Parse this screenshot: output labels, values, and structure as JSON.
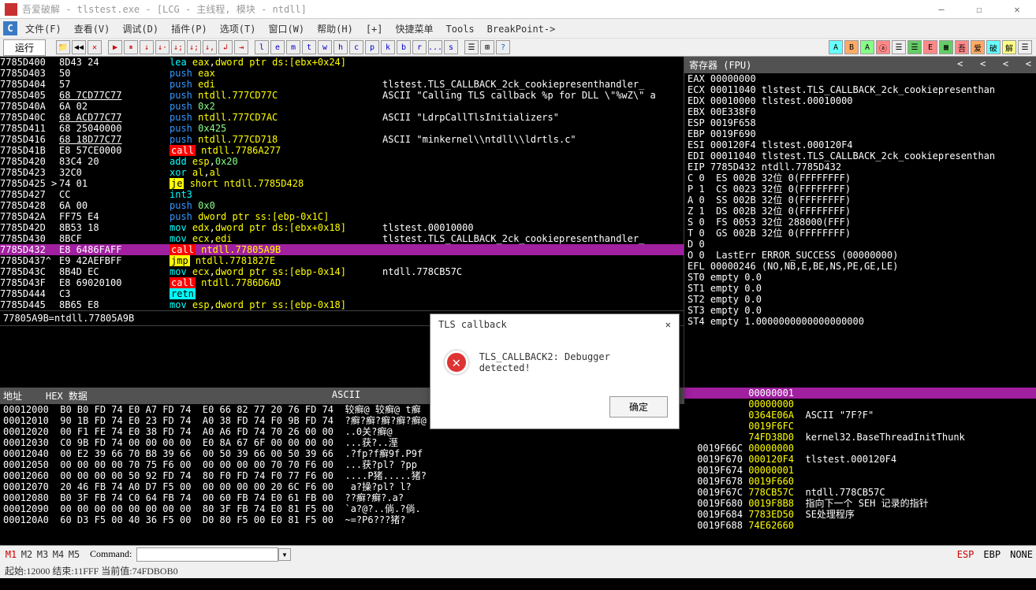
{
  "window": {
    "title": "吾爱破解 - tlstest.exe - [LCG - 主线程, 模块 - ntdll]"
  },
  "menu": [
    {
      "label": "文件(F)"
    },
    {
      "label": "查看(V)"
    },
    {
      "label": "调试(D)"
    },
    {
      "label": "插件(P)"
    },
    {
      "label": "选项(T)"
    },
    {
      "label": "窗口(W)"
    },
    {
      "label": "帮助(H)"
    },
    {
      "label": "[+]"
    },
    {
      "label": "快捷菜单"
    },
    {
      "label": "Tools"
    },
    {
      "label": "BreakPoint->"
    }
  ],
  "toolbar": {
    "run": "运行",
    "letters": [
      "l",
      "e",
      "m",
      "t",
      "w",
      "h",
      "c",
      "p",
      "k",
      "b",
      "r",
      "...",
      "s"
    ]
  },
  "disasm": [
    {
      "a": "7785D400",
      "b": "8D43 24",
      "i": [
        "lea",
        " ",
        "eax",
        ",",
        "dword ptr ds:[ebx+0x24]"
      ],
      "c": ""
    },
    {
      "a": "7785D403",
      "b": "50",
      "i": [
        "push",
        " ",
        "eax"
      ],
      "c": ""
    },
    {
      "a": "7785D404",
      "b": "57",
      "i": [
        "push",
        " ",
        "edi"
      ],
      "c": "tlstest.TLS_CALLBACK_2ck_cookiepresenthandler_"
    },
    {
      "a": "7785D405",
      "b": "68 7CD77C77",
      "i": [
        "push",
        " ",
        "ntdll.777CD77C"
      ],
      "c": "ASCII \"Calling TLS callback %p for DLL \\\"%wZ\\\" a",
      "u": true
    },
    {
      "a": "7785D40A",
      "b": "6A 02",
      "i": [
        "push",
        " ",
        "0x2"
      ],
      "c": ""
    },
    {
      "a": "7785D40C",
      "b": "68 ACD77C77",
      "i": [
        "push",
        " ",
        "ntdll.777CD7AC"
      ],
      "c": "ASCII \"LdrpCallTlsInitializers\"",
      "u": true
    },
    {
      "a": "7785D411",
      "b": "68 25040000",
      "i": [
        "push",
        " ",
        "0x425"
      ],
      "c": ""
    },
    {
      "a": "7785D416",
      "b": "68 18D77C77",
      "i": [
        "push",
        " ",
        "ntdll.777CD718"
      ],
      "c": "ASCII \"minkernel\\\\ntdll\\\\ldrtls.c\"",
      "u": true
    },
    {
      "a": "7785D41B",
      "b": "E8 57CE0000",
      "i": [
        "call",
        " ",
        "ntdll.7786A277"
      ],
      "c": ""
    },
    {
      "a": "7785D420",
      "b": "83C4 20",
      "i": [
        "add",
        " ",
        "esp",
        ",",
        "0x20"
      ],
      "c": ""
    },
    {
      "a": "7785D423",
      "b": "32C0",
      "i": [
        "xor",
        " ",
        "al",
        ",",
        "al"
      ],
      "c": ""
    },
    {
      "a": "7785D425",
      "b": "74 01",
      "i": [
        "je",
        " ",
        "short ntdll.7785D428"
      ],
      "c": "",
      "arrow": ">"
    },
    {
      "a": "7785D427",
      "b": "CC",
      "i": [
        "int3"
      ],
      "c": ""
    },
    {
      "a": "7785D428",
      "b": "6A 00",
      "i": [
        "push",
        " ",
        "0x0"
      ],
      "c": ""
    },
    {
      "a": "7785D42A",
      "b": "FF75 E4",
      "i": [
        "push",
        " ",
        "dword ptr ss:[ebp-0x1C]"
      ],
      "c": ""
    },
    {
      "a": "7785D42D",
      "b": "8B53 18",
      "i": [
        "mov",
        " ",
        "edx",
        ",",
        "dword ptr ds:[ebx+0x18]"
      ],
      "c": "tlstest.00010000"
    },
    {
      "a": "7785D430",
      "b": "8BCF",
      "i": [
        "mov",
        " ",
        "ecx",
        ",",
        "edi"
      ],
      "c": "tlstest.TLS_CALLBACK_2ck_cookiepresenthandler_"
    },
    {
      "a": "7785D432",
      "b": "E8 6486FAFF",
      "i": [
        "call",
        " ",
        "ntdll.77805A9B"
      ],
      "c": "",
      "hi": true
    },
    {
      "a": "7785D437",
      "b": "E9 42AEFBFF",
      "i": [
        "jmp",
        " ",
        "ntdll.7781827E"
      ],
      "c": "",
      "mark": "^"
    },
    {
      "a": "7785D43C",
      "b": "8B4D EC",
      "i": [
        "mov",
        " ",
        "ecx",
        ",",
        "dword ptr ss:[ebp-0x14]"
      ],
      "c": "ntdll.778CB57C"
    },
    {
      "a": "7785D43F",
      "b": "E8 69020100",
      "i": [
        "call",
        " ",
        "ntdll.7786D6AD"
      ],
      "c": ""
    },
    {
      "a": "7785D444",
      "b": "C3",
      "i": [
        "retn"
      ],
      "c": ""
    },
    {
      "a": "7785D445",
      "b": "8B65 E8",
      "i": [
        "mov",
        " ",
        "esp",
        ",",
        "dword ptr ss:[ebp-0x18]"
      ],
      "c": ""
    }
  ],
  "status_addr": "77805A9B=ntdll.77805A9B",
  "regs": {
    "title": "寄存器 (FPU)",
    "lines": [
      "EAX 00000000",
      "ECX 00011040 tlstest.TLS_CALLBACK_2ck_cookiepresenthan",
      "EDX 00010000 tlstest.00010000",
      "EBX 00E338F0",
      "ESP 0019F658",
      "EBP 0019F690",
      "ESI 000120F4 tlstest.000120F4",
      "EDI 00011040 tlstest.TLS_CALLBACK_2ck_cookiepresenthan",
      "",
      "EIP 7785D432 ntdll.7785D432",
      "",
      "C 0  ES 002B 32位 0(FFFFFFFF)",
      "P 1  CS 0023 32位 0(FFFFFFFF)",
      "A 0  SS 002B 32位 0(FFFFFFFF)",
      "Z 1  DS 002B 32位 0(FFFFFFFF)",
      "S 0  FS 0053 32位 288000(FFF)",
      "T 0  GS 002B 32位 0(FFFFFFFF)",
      "D 0",
      "O 0  LastErr ERROR_SUCCESS (00000000)",
      "",
      "EFL 00000246 (NO,NB,E,BE,NS,PE,GE,LE)",
      "",
      "ST0 empty 0.0",
      "ST1 empty 0.0",
      "ST2 empty 0.0",
      "ST3 empty 0.0",
      "ST4 empty 1.0000000000000000000"
    ]
  },
  "dump": {
    "hdr": {
      "addr": "地址",
      "hex": "HEX 数据",
      "ascii": "ASCII"
    },
    "rows": [
      {
        "a": "00012000",
        "h": "B0 B0 FD 74 E0 A7 FD 74  E0 66 82 77 20 76 FD 74",
        "s": "较癣@ 较癣@ t癣"
      },
      {
        "a": "00012010",
        "h": "90 1B FD 74 E0 23 FD 74  A0 38 FD 74 F0 9B FD 74",
        "s": "?癣?癣?癣?癣?癣@"
      },
      {
        "a": "00012020",
        "h": "00 F1 FE 74 E0 38 FD 74  A0 A6 FD 74 70 26 00 00",
        "s": "..0关?癣@"
      },
      {
        "a": "00012030",
        "h": "C0 9B FD 74 00 00 00 00  E0 8A 67 6F 00 00 00 00",
        "s": "...获?..溼"
      },
      {
        "a": "00012040",
        "h": "00 E2 39 66 70 B8 39 66  00 50 39 66 00 50 39 66",
        "s": ".?fp?f癣9f.P9f"
      },
      {
        "a": "00012050",
        "h": "00 00 00 00 70 75 F6 00  00 00 00 00 70 70 F6 00",
        "s": "...获?pl? ?pp"
      },
      {
        "a": "00012060",
        "h": "00 00 00 00 50 92 FD 74  80 F0 FD 74 F0 77 F6 00",
        "s": "....P猪.....猪?"
      },
      {
        "a": "00012070",
        "h": "20 46 FB 74 A0 D7 F5 00  00 00 00 00 20 6C F6 00",
        "s": " a?操?pl? l?"
      },
      {
        "a": "00012080",
        "h": "B0 3F FB 74 C0 64 FB 74  00 60 FB 74 E0 61 FB 00",
        "s": "??癣?癣?.a?"
      },
      {
        "a": "00012090",
        "h": "00 00 00 00 00 00 00 00  80 3F FB 74 E0 81 F5 00",
        "s": "`a?@?..倘.?倘."
      },
      {
        "a": "000120A0",
        "h": "60 D3 F5 00 40 36 F5 00  D0 80 F5 00 E0 81 F5 00",
        "s": "~=?P6???猪?"
      }
    ]
  },
  "stack": [
    {
      "a": "",
      "v": "00000001",
      "c": "",
      "hi": true
    },
    {
      "a": "",
      "v": "00000000",
      "c": ""
    },
    {
      "a": "",
      "v": "0364E06A",
      "c": "ASCII \"7F?F\""
    },
    {
      "a": "",
      "v": "0019F6FC",
      "c": ""
    },
    {
      "a": "",
      "v": "74FD38D0",
      "c": "kernel32.BaseThreadInitThunk"
    },
    {
      "a": "0019F66C",
      "v": "00000000",
      "c": ""
    },
    {
      "a": "0019F670",
      "v": "000120F4",
      "c": "tlstest.000120F4"
    },
    {
      "a": "0019F674",
      "v": "00000001",
      "c": ""
    },
    {
      "a": "0019F678",
      "v": "0019F660",
      "c": ""
    },
    {
      "a": "0019F67C",
      "v": "778CB57C",
      "c": "ntdll.778CB57C"
    },
    {
      "a": "0019F680",
      "v": "0019F8B8",
      "c": "指向下一个 SEH 记录的指针"
    },
    {
      "a": "0019F684",
      "v": "7783ED50",
      "c": "SE处理程序"
    },
    {
      "a": "0019F688",
      "v": "74E62660",
      "c": ""
    }
  ],
  "cmd": {
    "m": [
      "M1",
      "M2",
      "M3",
      "M4",
      "M5"
    ],
    "label": "Command:",
    "right": [
      "ESP",
      "EBP",
      "NONE"
    ]
  },
  "statusbar": "起始:12000 结束:11FFF 当前值:74FDBOB0",
  "dialog": {
    "title": "TLS callback",
    "msg": "TLS_CALLBACK2: Debugger detected!",
    "ok": "确定"
  }
}
